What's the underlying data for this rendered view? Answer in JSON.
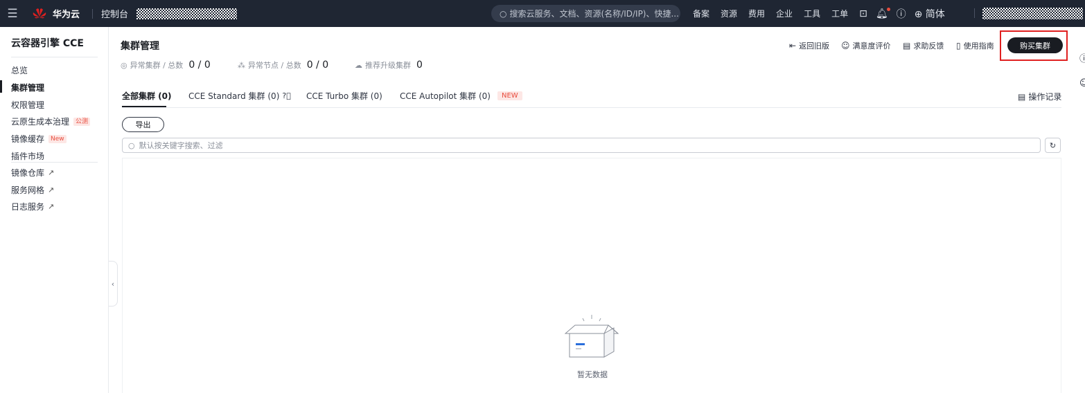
{
  "topbar": {
    "brand": "华为云",
    "console": "控制台",
    "search_placeholder": "搜索云服务、文档、资源(名称/ID/IP)、快捷...",
    "links": [
      "备案",
      "资源",
      "费用",
      "企业",
      "工具",
      "工单"
    ],
    "language": "简体"
  },
  "sidebar": {
    "title": "云容器引擎 CCE",
    "items": [
      {
        "label": "总览"
      },
      {
        "label": "集群管理"
      },
      {
        "label": "权限管理"
      },
      {
        "label": "云原生成本治理",
        "badge": "公测"
      },
      {
        "label": "镜像缓存",
        "badge": "New"
      },
      {
        "label": "插件市场"
      },
      {
        "label": "镜像仓库"
      },
      {
        "label": "服务网格"
      },
      {
        "label": "日志服务"
      }
    ]
  },
  "header": {
    "title": "集群管理",
    "stats": [
      {
        "label": "异常集群 / 总数",
        "value": "0 / 0"
      },
      {
        "label": "异常节点 / 总数",
        "value": "0 / 0"
      },
      {
        "label": "推荐升级集群",
        "value": "0"
      }
    ],
    "actions": [
      "返回旧版",
      "满意度评价",
      "求助反馈",
      "使用指南"
    ],
    "buy_button": "购买集群"
  },
  "tabs": [
    {
      "label": "全部集群 (0)"
    },
    {
      "label": "CCE Standard 集群 (0)"
    },
    {
      "label": "CCE Turbo 集群 (0)"
    },
    {
      "label": "CCE Autopilot 集群 (0)",
      "badge": "NEW"
    }
  ],
  "toolbar": {
    "operation_record": "操作记录",
    "export": "导出",
    "search_placeholder": "默认按关键字搜索、过滤"
  },
  "empty_state": {
    "text": "暂无数据"
  },
  "colors": {
    "topbar_bg": "#1f2633",
    "primary_button": "#191c22",
    "highlight_outline": "#e02020",
    "badge_red": "#e84c3d"
  }
}
